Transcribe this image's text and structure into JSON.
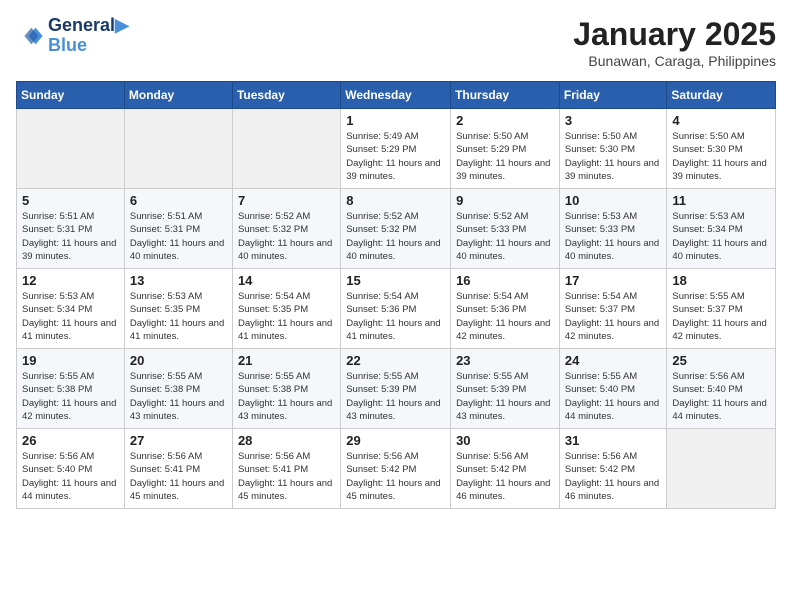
{
  "header": {
    "logo_line1": "General",
    "logo_line2": "Blue",
    "title": "January 2025",
    "subtitle": "Bunawan, Caraga, Philippines"
  },
  "days_of_week": [
    "Sunday",
    "Monday",
    "Tuesday",
    "Wednesday",
    "Thursday",
    "Friday",
    "Saturday"
  ],
  "weeks": [
    [
      {
        "day": "",
        "empty": true
      },
      {
        "day": "",
        "empty": true
      },
      {
        "day": "",
        "empty": true
      },
      {
        "day": "1",
        "sunrise": "5:49 AM",
        "sunset": "5:29 PM",
        "daylight": "11 hours and 39 minutes."
      },
      {
        "day": "2",
        "sunrise": "5:50 AM",
        "sunset": "5:29 PM",
        "daylight": "11 hours and 39 minutes."
      },
      {
        "day": "3",
        "sunrise": "5:50 AM",
        "sunset": "5:30 PM",
        "daylight": "11 hours and 39 minutes."
      },
      {
        "day": "4",
        "sunrise": "5:50 AM",
        "sunset": "5:30 PM",
        "daylight": "11 hours and 39 minutes."
      }
    ],
    [
      {
        "day": "5",
        "sunrise": "5:51 AM",
        "sunset": "5:31 PM",
        "daylight": "11 hours and 39 minutes."
      },
      {
        "day": "6",
        "sunrise": "5:51 AM",
        "sunset": "5:31 PM",
        "daylight": "11 hours and 40 minutes."
      },
      {
        "day": "7",
        "sunrise": "5:52 AM",
        "sunset": "5:32 PM",
        "daylight": "11 hours and 40 minutes."
      },
      {
        "day": "8",
        "sunrise": "5:52 AM",
        "sunset": "5:32 PM",
        "daylight": "11 hours and 40 minutes."
      },
      {
        "day": "9",
        "sunrise": "5:52 AM",
        "sunset": "5:33 PM",
        "daylight": "11 hours and 40 minutes."
      },
      {
        "day": "10",
        "sunrise": "5:53 AM",
        "sunset": "5:33 PM",
        "daylight": "11 hours and 40 minutes."
      },
      {
        "day": "11",
        "sunrise": "5:53 AM",
        "sunset": "5:34 PM",
        "daylight": "11 hours and 40 minutes."
      }
    ],
    [
      {
        "day": "12",
        "sunrise": "5:53 AM",
        "sunset": "5:34 PM",
        "daylight": "11 hours and 41 minutes."
      },
      {
        "day": "13",
        "sunrise": "5:53 AM",
        "sunset": "5:35 PM",
        "daylight": "11 hours and 41 minutes."
      },
      {
        "day": "14",
        "sunrise": "5:54 AM",
        "sunset": "5:35 PM",
        "daylight": "11 hours and 41 minutes."
      },
      {
        "day": "15",
        "sunrise": "5:54 AM",
        "sunset": "5:36 PM",
        "daylight": "11 hours and 41 minutes."
      },
      {
        "day": "16",
        "sunrise": "5:54 AM",
        "sunset": "5:36 PM",
        "daylight": "11 hours and 42 minutes."
      },
      {
        "day": "17",
        "sunrise": "5:54 AM",
        "sunset": "5:37 PM",
        "daylight": "11 hours and 42 minutes."
      },
      {
        "day": "18",
        "sunrise": "5:55 AM",
        "sunset": "5:37 PM",
        "daylight": "11 hours and 42 minutes."
      }
    ],
    [
      {
        "day": "19",
        "sunrise": "5:55 AM",
        "sunset": "5:38 PM",
        "daylight": "11 hours and 42 minutes."
      },
      {
        "day": "20",
        "sunrise": "5:55 AM",
        "sunset": "5:38 PM",
        "daylight": "11 hours and 43 minutes."
      },
      {
        "day": "21",
        "sunrise": "5:55 AM",
        "sunset": "5:38 PM",
        "daylight": "11 hours and 43 minutes."
      },
      {
        "day": "22",
        "sunrise": "5:55 AM",
        "sunset": "5:39 PM",
        "daylight": "11 hours and 43 minutes."
      },
      {
        "day": "23",
        "sunrise": "5:55 AM",
        "sunset": "5:39 PM",
        "daylight": "11 hours and 43 minutes."
      },
      {
        "day": "24",
        "sunrise": "5:55 AM",
        "sunset": "5:40 PM",
        "daylight": "11 hours and 44 minutes."
      },
      {
        "day": "25",
        "sunrise": "5:56 AM",
        "sunset": "5:40 PM",
        "daylight": "11 hours and 44 minutes."
      }
    ],
    [
      {
        "day": "26",
        "sunrise": "5:56 AM",
        "sunset": "5:40 PM",
        "daylight": "11 hours and 44 minutes."
      },
      {
        "day": "27",
        "sunrise": "5:56 AM",
        "sunset": "5:41 PM",
        "daylight": "11 hours and 45 minutes."
      },
      {
        "day": "28",
        "sunrise": "5:56 AM",
        "sunset": "5:41 PM",
        "daylight": "11 hours and 45 minutes."
      },
      {
        "day": "29",
        "sunrise": "5:56 AM",
        "sunset": "5:42 PM",
        "daylight": "11 hours and 45 minutes."
      },
      {
        "day": "30",
        "sunrise": "5:56 AM",
        "sunset": "5:42 PM",
        "daylight": "11 hours and 46 minutes."
      },
      {
        "day": "31",
        "sunrise": "5:56 AM",
        "sunset": "5:42 PM",
        "daylight": "11 hours and 46 minutes."
      },
      {
        "day": "",
        "empty": true
      }
    ]
  ],
  "labels": {
    "sunrise_prefix": "Sunrise: ",
    "sunset_prefix": "Sunset: ",
    "daylight_label": "Daylight hours"
  }
}
